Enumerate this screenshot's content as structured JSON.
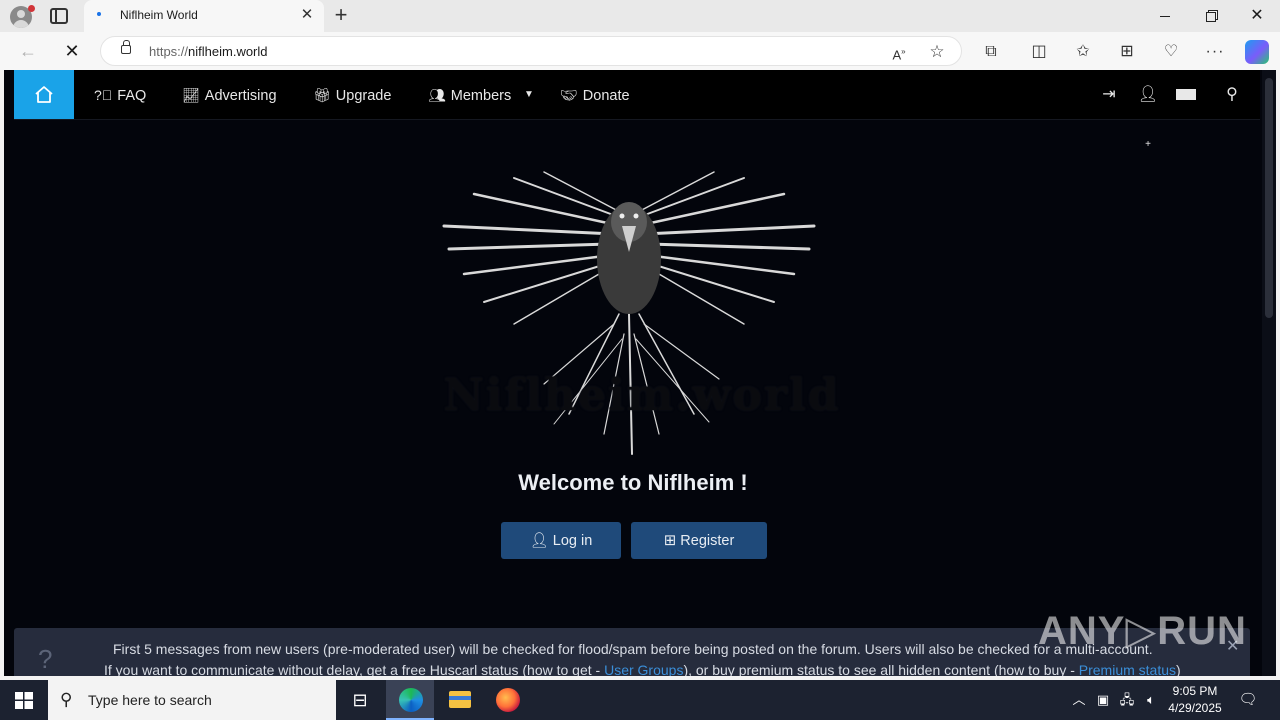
{
  "browser": {
    "tab_title": "Niflheim World",
    "new_tab": "+",
    "tab_close": "✕",
    "url_scheme": "https://",
    "url_host": "niflheim.world",
    "back": "←",
    "reload": "✕",
    "more": "···",
    "window_min": "",
    "window_close": "✕"
  },
  "site": {
    "nav": {
      "faq": "FAQ",
      "advertising": "Advertising",
      "upgrade": "Upgrade",
      "members": "Members",
      "donate": "Donate"
    },
    "logo_text": "Niflheim.world",
    "welcome": "Welcome to Niflheim !",
    "login_button": "Log in",
    "register_button": "Register",
    "notice": {
      "icon": "?",
      "line1": "First 5 messages from new users (pre-moderated user) will be checked for flood/spam before being posted on the forum. Users will also be checked for a multi-account.",
      "line2_a": "If you want to communicate without delay, get a free Huscarl status (how to get - ",
      "line2_link1": "User Groups",
      "line2_b": "), or buy premium status to see all hidden content (how to buy - ",
      "line2_link2": "Premium status",
      "line2_c": ")",
      "close": "✕"
    }
  },
  "watermark": "ANY▷RUN",
  "taskbar": {
    "search_placeholder": "Type here to search",
    "time": "9:05 PM",
    "date": "4/29/2025"
  },
  "colors": {
    "nav_home_active": "#1aa3e8",
    "button_bg": "#1f4a7a",
    "page_bg": "#03050c",
    "notice_bg": "#262c3d",
    "link": "#3b8fd9"
  }
}
